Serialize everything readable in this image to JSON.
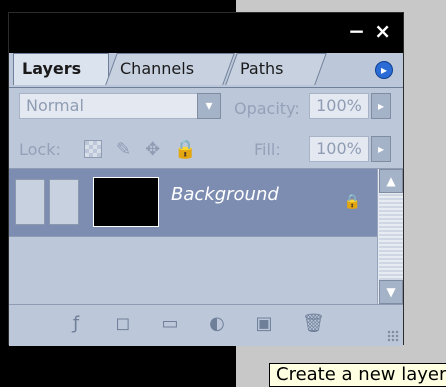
{
  "tabs": {
    "layers": "Layers",
    "channels": "Channels",
    "paths": "Paths"
  },
  "controls": {
    "blend_mode": "Normal",
    "opacity_label": "Opacity:",
    "opacity_value": "100%",
    "lock_label": "Lock:",
    "fill_label": "Fill:",
    "fill_value": "100%"
  },
  "layers": [
    {
      "name": "Background",
      "selected": true
    }
  ],
  "tooltip": "Create a new layer",
  "icons": {
    "window": [
      "minimize-icon",
      "close-icon"
    ],
    "panel_menu": "menu-arrow-icon",
    "lock": [
      "lock-transparent-icon",
      "lock-image-icon",
      "lock-position-icon",
      "lock-all-icon"
    ],
    "footer": [
      "layer-style-icon",
      "layer-mask-icon",
      "new-group-icon",
      "adjustment-layer-icon",
      "new-layer-icon",
      "trash-icon"
    ]
  },
  "colors": {
    "panel_bg": "#bcc7d9",
    "selected_row": "#7d8db2",
    "title_bar": "#000000"
  }
}
